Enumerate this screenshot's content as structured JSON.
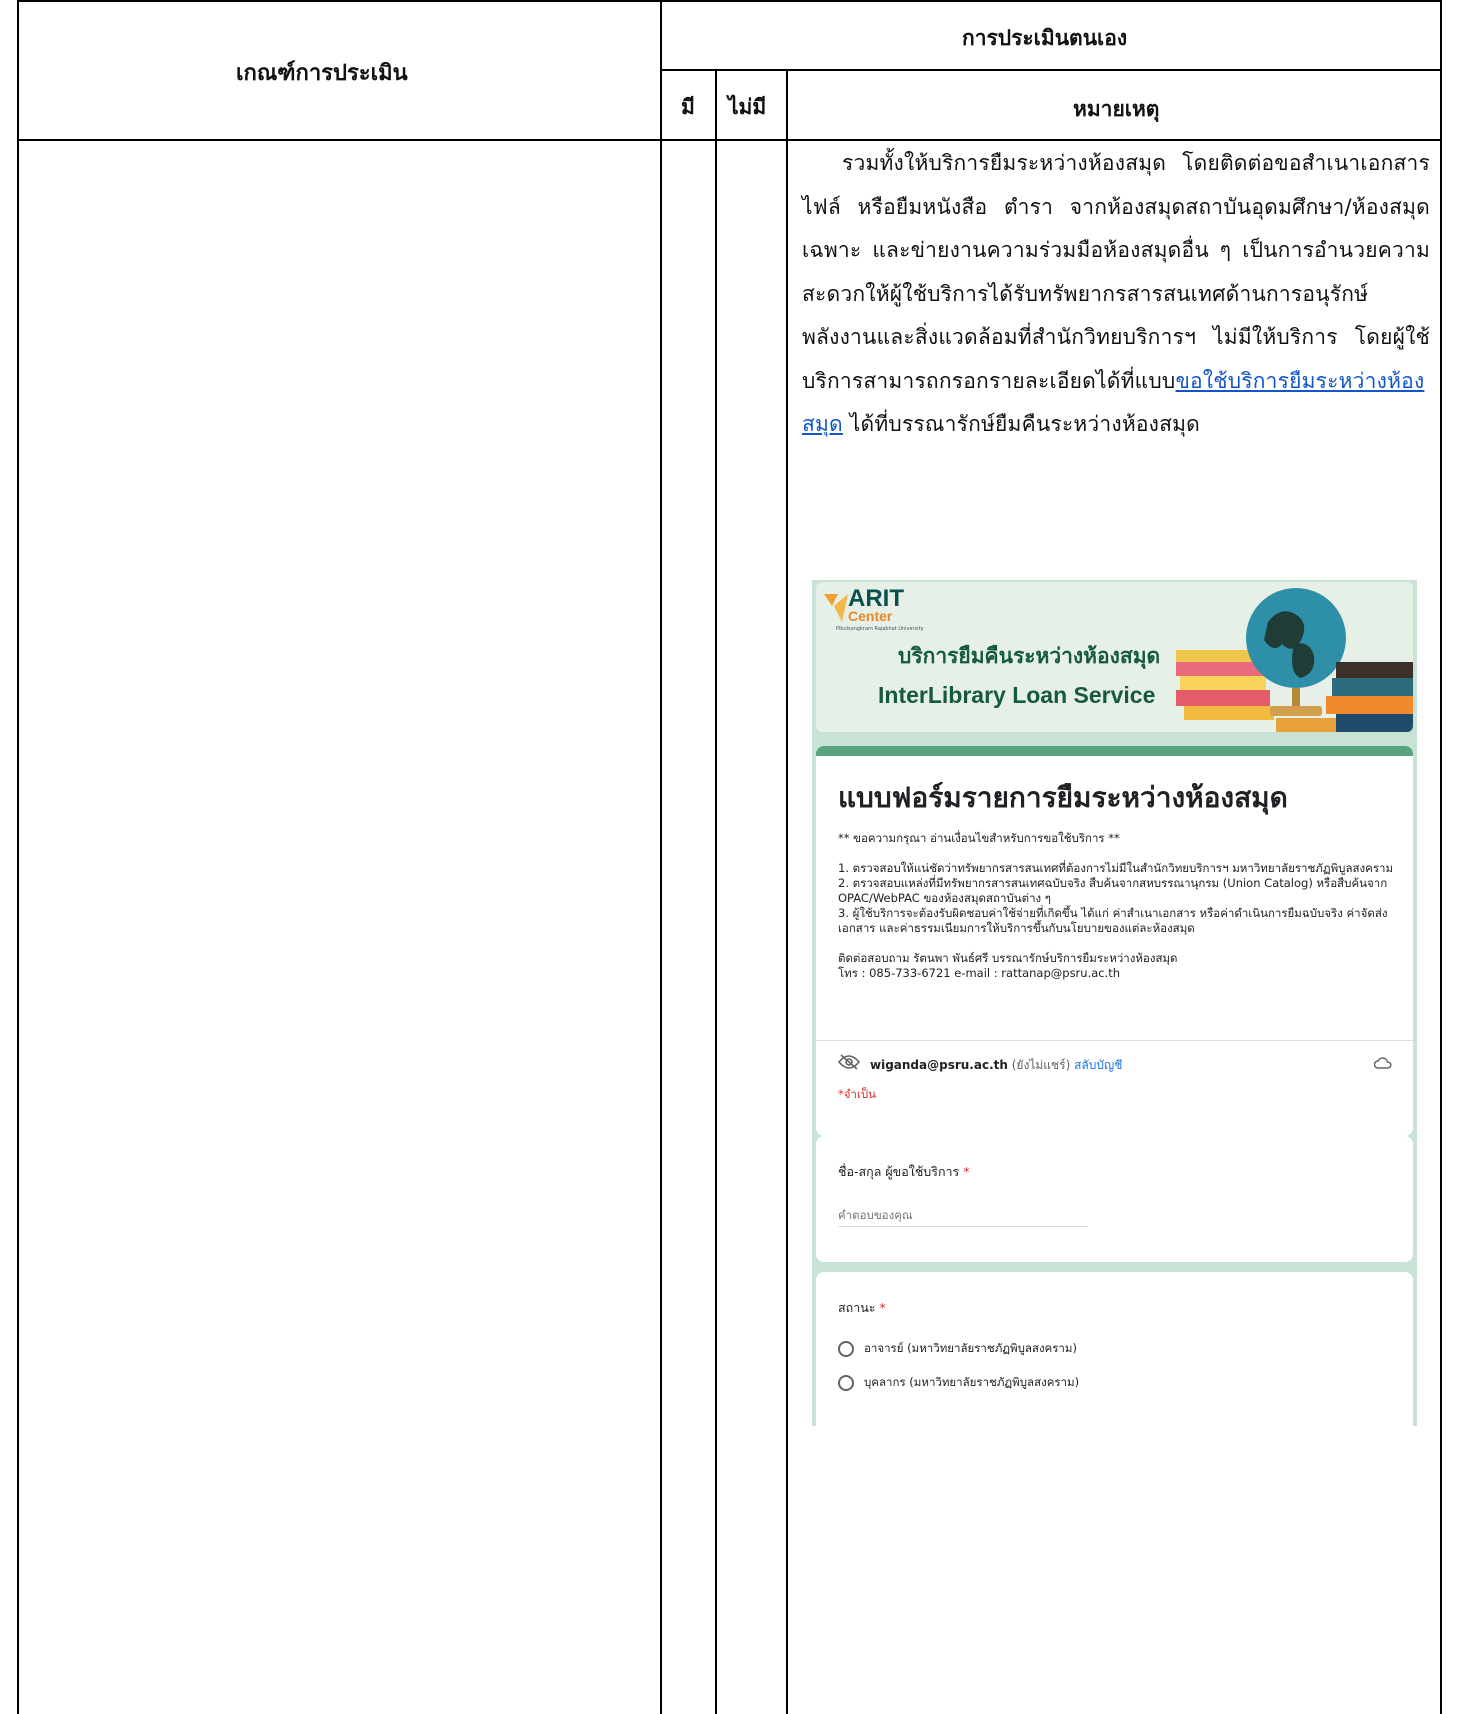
{
  "table": {
    "header_criteria": "เกณฑ์การประเมิน",
    "header_self_assessment": "การประเมินตนเอง",
    "header_have": "มี",
    "header_not_have": "ไม่มี",
    "header_remark": "หมายเหตุ"
  },
  "remark": {
    "text_before_link": "รวมทั้งให้บริการยืมระหว่างห้องสมุด โดยติดต่อขอสำเนาเอกสาร ไฟล์ หรือยืมหนังสือ ตำรา จากห้องสมุดสถาบันอุดมศึกษา/ห้องสมุดเฉพาะ และข่ายงานความร่วมมือห้องสมุดอื่น ๆ เป็นการอำนวยความสะดวกให้ผู้ใช้บริการได้รับทรัพยากรสารสนเทศด้านการอนุรักษ์พลังงานและสิ่งแวดล้อมที่สำนักวิทยบริการฯ ไม่มีให้บริการ โดยผู้ใช้บริการสามารถกรอกรายละเอียดได้ที่แบบ",
    "link_text": "ขอใช้บริการยืมระหว่างห้องสมุด",
    "text_after_link": " ได้ที่บรรณารักษ์ยืมคืนระหว่างห้องสมุด"
  },
  "form_screenshot": {
    "logo_title": "ARIT",
    "logo_sub": "Center",
    "logo_tiny": "Pibulsongkram Rajabhat University",
    "banner_th": "บริการยืมคืนระหว่างห้องสมุด",
    "banner_en": "InterLibrary Loan Service",
    "form_title": "แบบฟอร์มรายการยืมระหว่างห้องสมุด",
    "form_description": "** ขอความกรุณา อ่านเงื่อนไขสำหรับการขอใช้บริการ **\n\n1. ตรวจสอบให้แน่ชัดว่าทรัพยากรสารสนเทศที่ต้องการไม่มีในสำนักวิทยบริการฯ มหาวิทยาลัยราชภัฏพิบูลสงคราม\n2. ตรวจสอบแหล่งที่มีทรัพยากรสารสนเทศฉบับจริง สืบค้นจากสหบรรณานุกรม (Union Catalog) หรือสืบค้นจาก OPAC/WebPAC ของห้องสมุดสถาบันต่าง ๆ\n3. ผู้ใช้บริการจะต้องรับผิดชอบค่าใช้จ่ายที่เกิดขึ้น ได้แก่ ค่าสำเนาเอกสาร หรือค่าดำเนินการยืมฉบับจริง ค่าจัดส่งเอกสาร และค่าธรรมเนียมการให้บริการขึ้นกับนโยบายของแต่ละห้องสมุด\n\nติดต่อสอบถาม รัตนพา พันธ์ศรี บรรณารักษ์บริการยืมระหว่างห้องสมุด\nโทร : 085-733-6721 e-mail : rattanap@psru.ac.th",
    "account_email": "wiganda@psru.ac.th",
    "account_note": "(ยังไม่แชร์)",
    "account_switch": "สลับบัญชี",
    "required_note": "*จำเป็น",
    "q1_label": "ชื่อ-สกุล ผู้ขอใช้บริการ",
    "q1_placeholder": "คำตอบของคุณ",
    "q2_label": "สถานะ",
    "q2_options": [
      "อาจารย์ (มหาวิทยาลัยราชภัฏพิบูลสงคราม)",
      "บุคลากร (มหาวิทยาลัยราชภัฏพิบูลสงคราม)"
    ],
    "required_star": "*"
  }
}
